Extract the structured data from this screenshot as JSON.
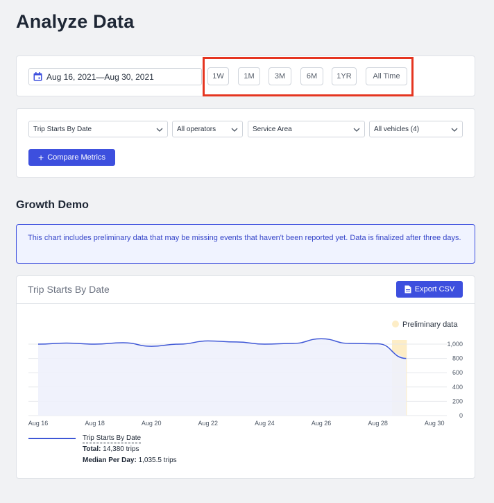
{
  "page": {
    "title": "Analyze Data"
  },
  "date_filter": {
    "range_text": "Aug 16, 2021—Aug 30, 2021",
    "ranges": [
      "1W",
      "1M",
      "3M",
      "6M",
      "1YR",
      "All Time"
    ]
  },
  "filters": {
    "metric": "Trip Starts By Date",
    "operators": "All operators",
    "area": "Service Area",
    "vehicles": "All vehicles (4)",
    "compare_label": "Compare Metrics"
  },
  "section": {
    "title": "Growth Demo"
  },
  "notice": {
    "text": "This chart includes preliminary data that may be missing events that haven't been reported yet. Data is finalized after three days."
  },
  "chart": {
    "title": "Trip Starts By Date",
    "export_label": "Export CSV",
    "preliminary_label": "Preliminary data",
    "series_name": "Trip Starts By Date",
    "total_label": "Total:",
    "total_value": "14,380 trips",
    "median_label": "Median Per Day:",
    "median_value": "1,035.5 trips"
  },
  "chart_data": {
    "type": "area",
    "x": [
      "Aug 16",
      "Aug 17",
      "Aug 18",
      "Aug 19",
      "Aug 20",
      "Aug 21",
      "Aug 22",
      "Aug 23",
      "Aug 24",
      "Aug 25",
      "Aug 26",
      "Aug 27",
      "Aug 28",
      "Aug 29"
    ],
    "values": [
      1000,
      1015,
      1000,
      1020,
      970,
      1000,
      1045,
      1030,
      1000,
      1010,
      1075,
      1010,
      1005,
      800
    ],
    "x_tick_labels": [
      "Aug 16",
      "Aug 18",
      "Aug 20",
      "Aug 22",
      "Aug 24",
      "Aug 26",
      "Aug 28",
      "Aug 30"
    ],
    "y_tick_labels": [
      "1,000",
      "800",
      "600",
      "400",
      "200",
      "0"
    ],
    "y_ticks": [
      1000,
      800,
      600,
      400,
      200,
      0
    ],
    "ylim": [
      0,
      1000
    ],
    "preliminary_from": "Aug 28.5",
    "grid": true,
    "legend": "top-right",
    "colors": {
      "line": "#3e57d6",
      "fill": "#eef1fc",
      "preliminary": "#fdedc6"
    }
  }
}
